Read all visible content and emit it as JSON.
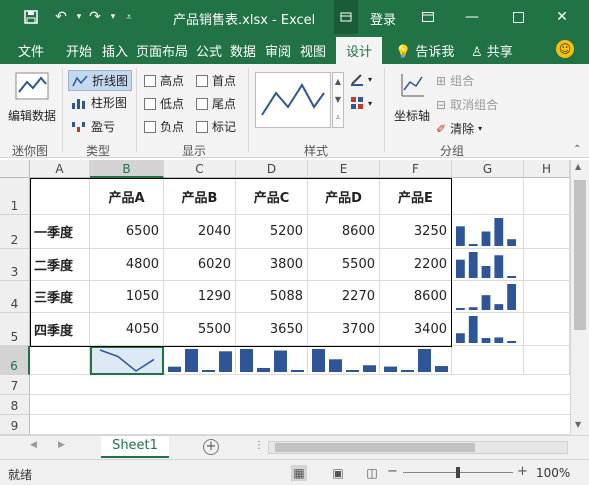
{
  "titlebar": {
    "title": "产品销售表.xlsx - Excel",
    "login": "登录",
    "ribbon_options_icon": "ribbon-options-icon"
  },
  "tabs": [
    {
      "label": "文件"
    },
    {
      "label": "开始"
    },
    {
      "label": "插入"
    },
    {
      "label": "页面布局"
    },
    {
      "label": "公式"
    },
    {
      "label": "数据"
    },
    {
      "label": "审阅"
    },
    {
      "label": "视图"
    },
    {
      "label": "设计"
    }
  ],
  "tell_me": "告诉我",
  "share": "共享",
  "ribbon": {
    "edit_data": "编辑数据",
    "group_sparkline": "迷你图",
    "type_line": "折线图",
    "type_column": "柱形图",
    "type_winloss": "盈亏",
    "group_type": "类型",
    "show_high": "高点",
    "show_first": "首点",
    "show_low": "低点",
    "show_last": "尾点",
    "show_negative": "负点",
    "show_markers": "标记",
    "group_show": "显示",
    "group_style": "样式",
    "axis": "坐标轴",
    "group_btn": "组合",
    "ungroup_btn": "取消组合",
    "clear_btn": "清除",
    "group_group": "分组"
  },
  "columns": [
    "A",
    "B",
    "C",
    "D",
    "E",
    "F",
    "G",
    "H"
  ],
  "rows": [
    "1",
    "2",
    "3",
    "4",
    "5",
    "6",
    "7",
    "8",
    "9"
  ],
  "table": {
    "headers": [
      "产品A",
      "产品B",
      "产品C",
      "产品D",
      "产品E"
    ],
    "row_labels": [
      "一季度",
      "二季度",
      "三季度",
      "四季度"
    ],
    "values": [
      [
        "6500",
        "2040",
        "5200",
        "8600",
        "3250"
      ],
      [
        "4800",
        "6020",
        "3800",
        "5500",
        "2200"
      ],
      [
        "1050",
        "1290",
        "5088",
        "2270",
        "8600"
      ],
      [
        "4050",
        "5500",
        "3650",
        "3700",
        "3400"
      ]
    ]
  },
  "sparkline_color": "#2e5597",
  "sheet": {
    "tab": "Sheet1"
  },
  "status": {
    "ready": "就绪",
    "zoom": "100%"
  }
}
